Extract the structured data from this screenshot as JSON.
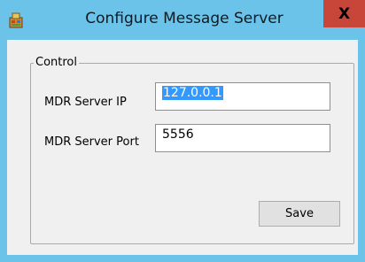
{
  "window": {
    "title": "Configure Message Server",
    "close_label": "X"
  },
  "group": {
    "legend": "Control"
  },
  "fields": {
    "server_ip_label": "MDR Server IP",
    "server_ip_value": "127.0.0.1",
    "server_port_label": "MDR Server Port",
    "server_port_value": "5556"
  },
  "actions": {
    "save_label": "Save"
  },
  "colors": {
    "titlebar": "#6cc3ea",
    "close_button": "#c8453a",
    "selection": "#3399ff"
  },
  "icons": {
    "app": "application-icon",
    "close": "close-icon"
  }
}
